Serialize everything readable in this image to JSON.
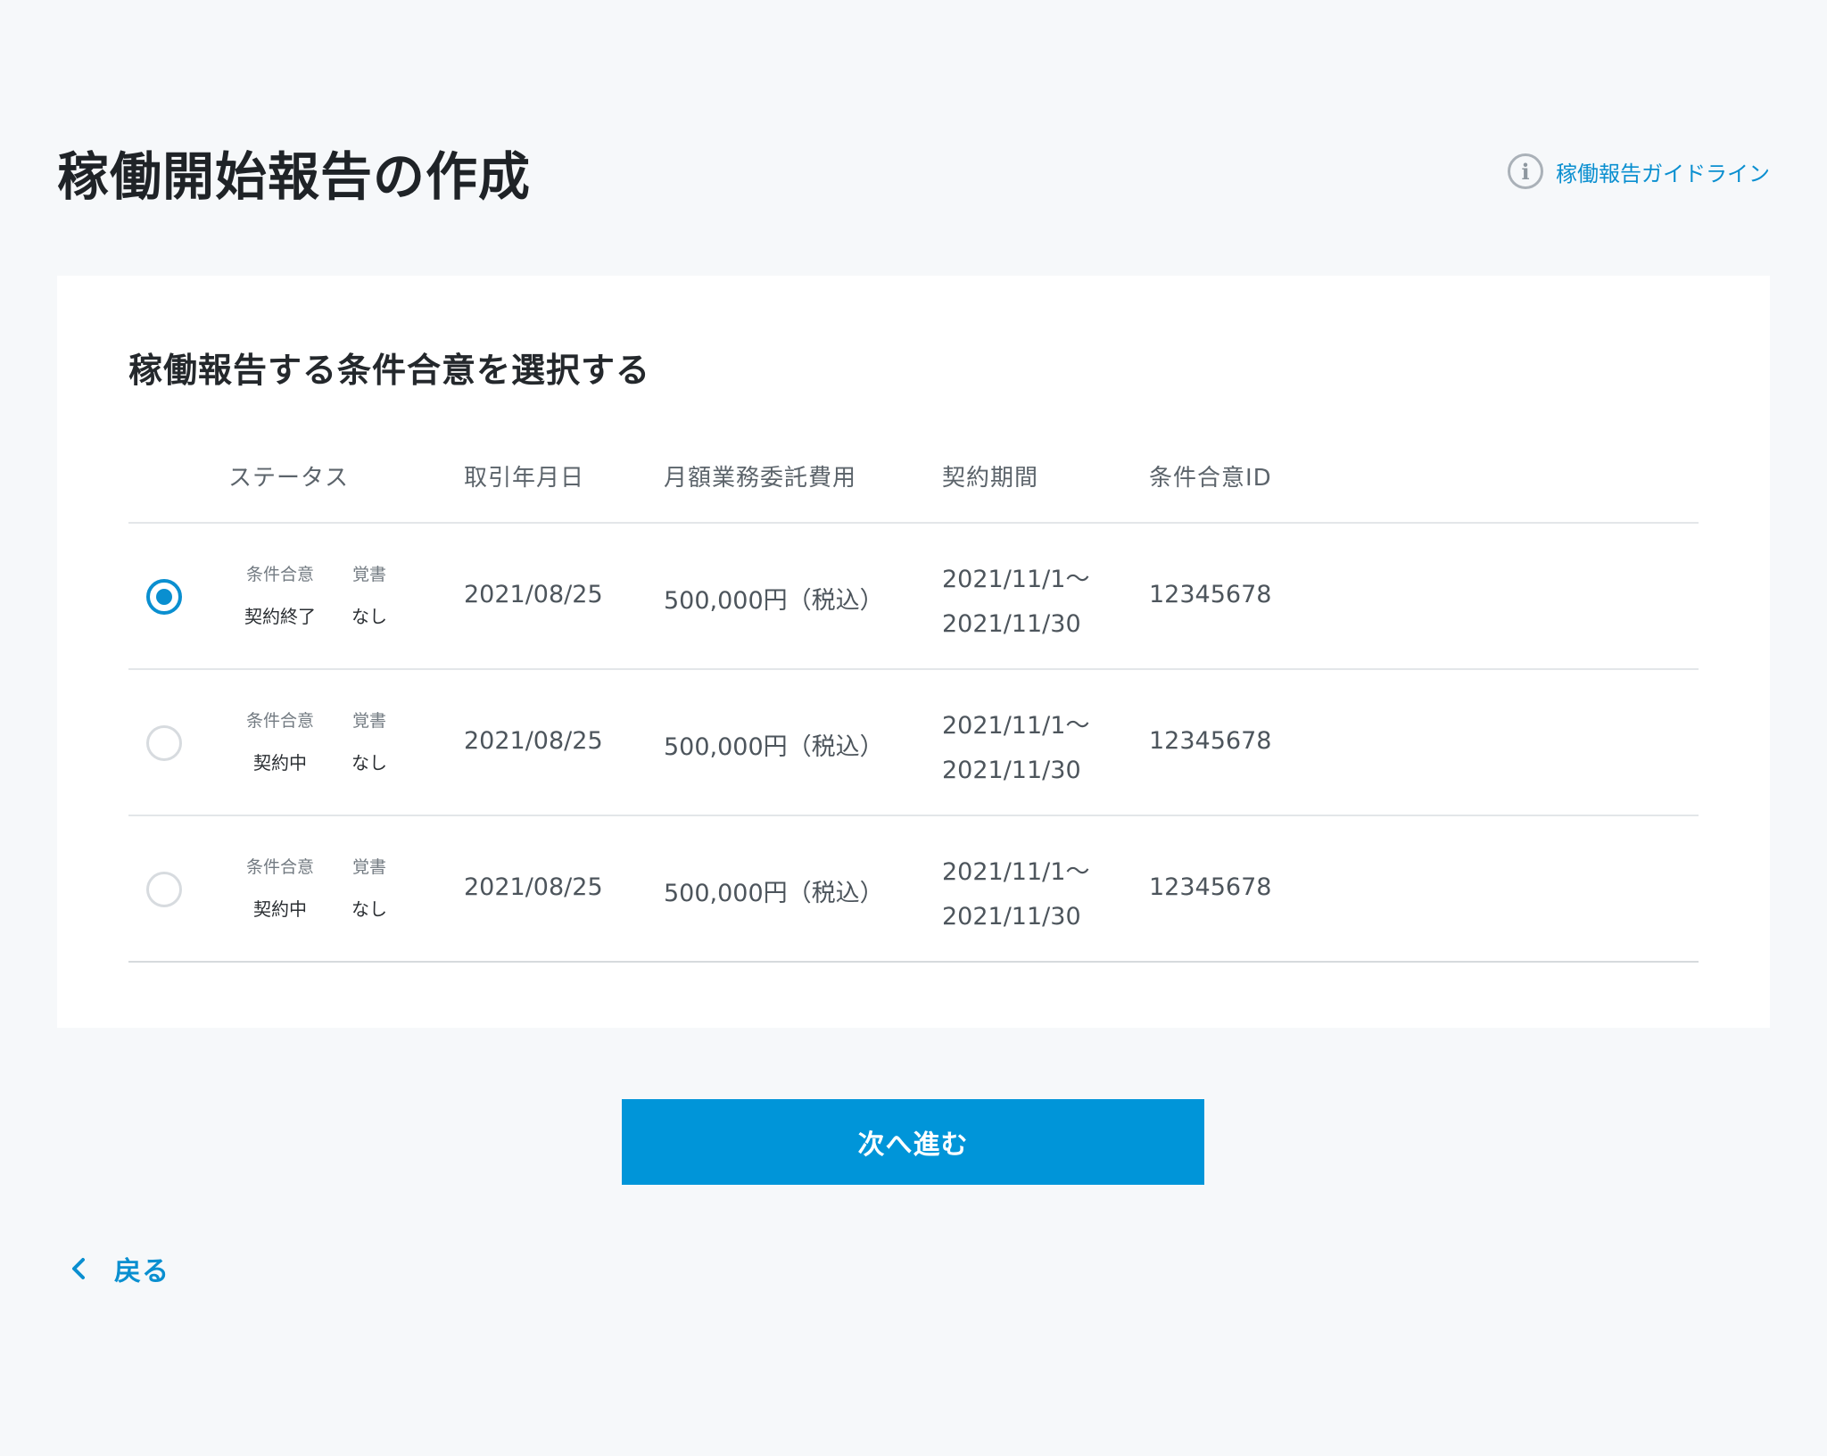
{
  "header": {
    "title": "稼働開始報告の作成",
    "guide_link": "稼働報告ガイドライン",
    "guide_icon": "info-icon"
  },
  "card": {
    "title": "稼働報告する条件合意を選択する"
  },
  "table": {
    "headers": {
      "status": "ステータス",
      "date": "取引年月日",
      "fee": "月額業務委託費用",
      "period": "契約期間",
      "id": "条件合意ID"
    },
    "rows": [
      {
        "selected": true,
        "status_label_1": "条件合意",
        "status_value_1": "契約終了",
        "status_label_2": "覚書",
        "status_value_2": "なし",
        "date": "2021/08/25",
        "fee": "500,000円（税込）",
        "period_start": "2021/11/1〜",
        "period_end": "2021/11/30",
        "id": "12345678"
      },
      {
        "selected": false,
        "status_label_1": "条件合意",
        "status_value_1": "契約中",
        "status_label_2": "覚書",
        "status_value_2": "なし",
        "date": "2021/08/25",
        "fee": "500,000円（税込）",
        "period_start": "2021/11/1〜",
        "period_end": "2021/11/30",
        "id": "12345678"
      },
      {
        "selected": false,
        "status_label_1": "条件合意",
        "status_value_1": "契約中",
        "status_label_2": "覚書",
        "status_value_2": "なし",
        "date": "2021/08/25",
        "fee": "500,000円（税込）",
        "period_start": "2021/11/1〜",
        "period_end": "2021/11/30",
        "id": "12345678"
      }
    ]
  },
  "actions": {
    "next_label": "次へ進む",
    "back_label": "戻る"
  },
  "colors": {
    "accent": "#0095d9",
    "link": "#0a8fd0",
    "background": "#f6f8fa"
  }
}
